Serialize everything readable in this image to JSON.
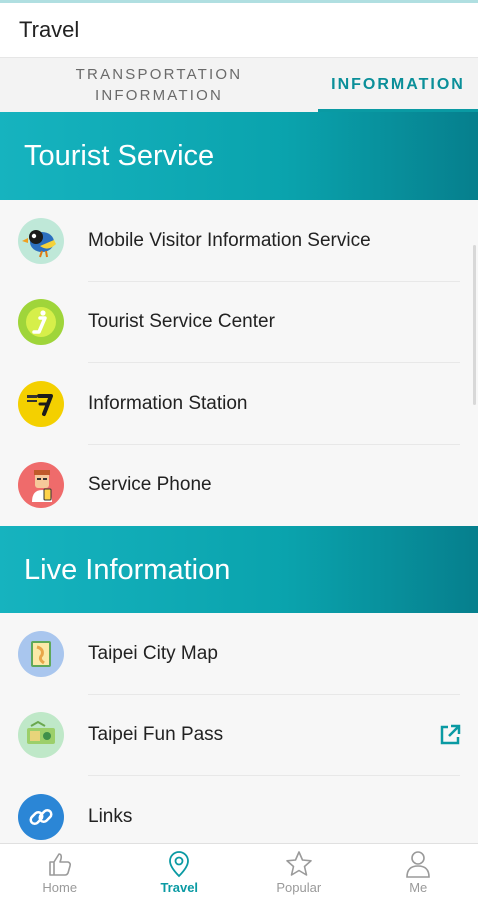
{
  "appbar": {
    "title": "Travel"
  },
  "tabs": [
    {
      "line1": "TRANSPORTATION",
      "line2": "INFORMATION",
      "active": false
    },
    {
      "label": "INFORMATION",
      "active": true
    }
  ],
  "sections": [
    {
      "title": "Tourist Service",
      "items": [
        {
          "label": "Mobile Visitor Information Service",
          "icon": "bird-mascot-icon"
        },
        {
          "label": "Tourist Service Center",
          "icon": "info-i-icon"
        },
        {
          "label": "Information Station",
          "icon": "info-station-icon"
        },
        {
          "label": "Service Phone",
          "icon": "phone-person-icon"
        }
      ]
    },
    {
      "title": "Live Information",
      "items": [
        {
          "label": "Taipei City Map",
          "icon": "city-map-icon"
        },
        {
          "label": "Taipei Fun Pass",
          "icon": "fun-pass-icon",
          "external": true
        },
        {
          "label": "Links",
          "icon": "link-icon"
        }
      ]
    }
  ],
  "bottom_nav": [
    {
      "label": "Home",
      "icon": "thumbs-up-icon",
      "active": false
    },
    {
      "label": "Travel",
      "icon": "location-pin-icon",
      "active": true
    },
    {
      "label": "Popular",
      "icon": "star-icon",
      "active": false
    },
    {
      "label": "Me",
      "icon": "person-icon",
      "active": false
    }
  ],
  "colors": {
    "accent": "#0a9aa3",
    "section_start": "#16b3bf",
    "section_end": "#067f8d"
  }
}
